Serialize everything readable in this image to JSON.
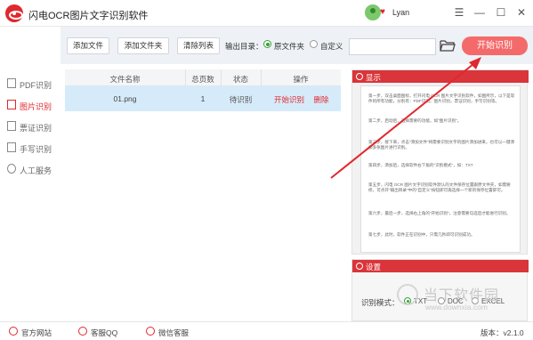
{
  "app": {
    "title": "闪电OCR图片文字识别软件"
  },
  "user": {
    "name": "Lyan"
  },
  "window_controls": [
    "menu-icon",
    "minimize-icon",
    "maximize-icon",
    "close-icon"
  ],
  "sidebar": {
    "items": [
      {
        "label": "PDF识别",
        "icon": "pdf-icon",
        "active": false
      },
      {
        "label": "图片识别",
        "icon": "image-icon",
        "active": true
      },
      {
        "label": "票证识别",
        "icon": "card-icon",
        "active": false
      },
      {
        "label": "手写识别",
        "icon": "handwrite-icon",
        "active": false
      },
      {
        "label": "人工服务",
        "icon": "smile-icon",
        "active": false
      }
    ]
  },
  "toolbar": {
    "add_file": "添加文件",
    "add_folder": "添加文件夹",
    "clear_list": "清除列表",
    "output_label": "输出目录：",
    "output_options": [
      "原文件夹",
      "自定义"
    ],
    "selected_output": "原文件夹",
    "path_value": "",
    "start_label": "开始识别"
  },
  "table": {
    "headers": [
      "文件名称",
      "总页数",
      "状态",
      "操作"
    ],
    "rows": [
      {
        "name": "01.png",
        "pages": "1",
        "status": "待识别",
        "action_start": "开始识别",
        "action_delete": "删除"
      }
    ]
  },
  "preview": {
    "title": "显示",
    "lines": [
      "第一步，双击桌面图标，打开闪电 OCR 图片文字识别软件，如图所示，以下是软件的所有功能，分别有：PDF识别，图片识别，票证识别，手写识别等。",
      "第二步，启动后，选择需要的功能，如\"图片识别\"。",
      "第三步，接下来，点击\"添加文件\"将需要识别文字的图片添加进来，也可以一键添加多张图片进行识别。",
      "第四步，添加后，选择软件右下角的\"识别模式\"，如：TXT",
      "第五步，闪电 OCR 图片文字识别软件默认的文件保存位置跟原文件夹，如需要修，可点开\"输出目录\"中的\"自定义\"按钮即可再选择一个新的保存位置即可。",
      "第六步，最后一步，选择右上角的\"开始识别\"，注意需要勾选后才能进行识别。",
      "第七步，此时，软件正在识别中，只需几秒即可识别成功。"
    ]
  },
  "settings": {
    "title": "设置",
    "mode_label": "识别模式：",
    "modes": [
      "TXT",
      "DOC",
      "EXCEL"
    ],
    "selected_mode": "TXT"
  },
  "watermark": {
    "text": "当下软件园",
    "url": "www.downxia.com"
  },
  "bottombar": {
    "website": "官方网站",
    "qq": "客服QQ",
    "wechat": "微信客服",
    "version": "版本：v2.1.0"
  },
  "colors": {
    "accent": "#e0282e",
    "start_button": "#f46a6a",
    "row_selected": "#d6ebfa",
    "radio_checked": "#3aa03a"
  }
}
